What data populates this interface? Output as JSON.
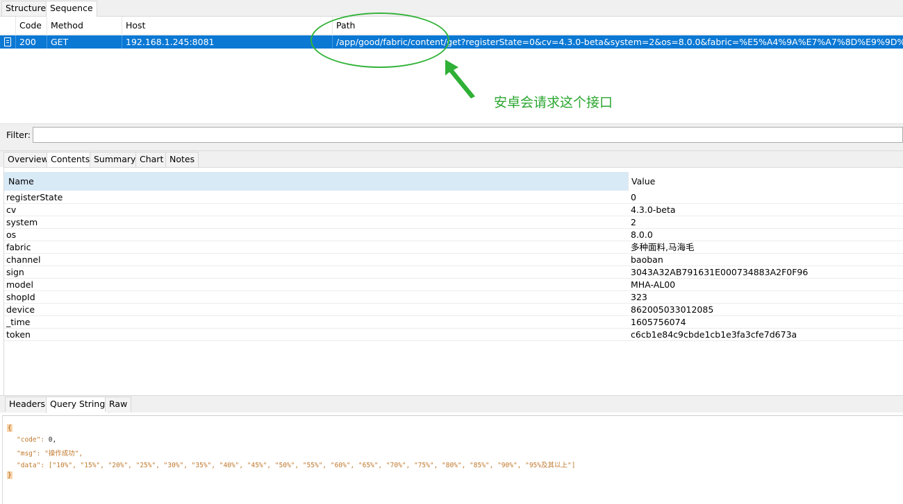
{
  "top_tabs": {
    "structure": "Structure",
    "sequence": "Sequence"
  },
  "sequence_table": {
    "columns": {
      "code": "Code",
      "method": "Method",
      "host": "Host",
      "path": "Path"
    },
    "row": {
      "code": "200",
      "method": "GET",
      "host": "192.168.1.245:8081",
      "path": "/app/good/fabric/content/get?registerState=0&cv=4.3.0-beta&system=2&os=8.0.0&fabric=%E5%A4%9A%E7%A7%8D%E9%9D%A2%E6%96"
    }
  },
  "annotation": {
    "text": "安卓会请求这个接口",
    "color": "#2aa62f"
  },
  "filter": {
    "label": "Filter:",
    "value": ""
  },
  "detail_tabs": {
    "overview": "Overview",
    "contents": "Contents",
    "summary": "Summary",
    "chart": "Chart",
    "notes": "Notes"
  },
  "contents_table": {
    "headers": {
      "name": "Name",
      "value": "Value"
    },
    "rows": [
      {
        "name": "registerState",
        "value": "0"
      },
      {
        "name": "cv",
        "value": "4.3.0-beta"
      },
      {
        "name": "system",
        "value": "2"
      },
      {
        "name": "os",
        "value": "8.0.0"
      },
      {
        "name": "fabric",
        "value": "多种面料,马海毛"
      },
      {
        "name": "channel",
        "value": "baoban"
      },
      {
        "name": "sign",
        "value": "3043A32AB791631E000734883A2F0F96"
      },
      {
        "name": "model",
        "value": "MHA-AL00"
      },
      {
        "name": "shopId",
        "value": "323"
      },
      {
        "name": "device",
        "value": "862005033012085"
      },
      {
        "name": "_time",
        "value": "1605756074"
      },
      {
        "name": "token",
        "value": "c6cb1e84c9cbde1cb1e3fa3cfe7d673a"
      }
    ]
  },
  "bottom_tabs": {
    "headers": "Headers",
    "query_string": "Query String",
    "raw": "Raw"
  },
  "response": {
    "open_brace": "{",
    "code_key": "\"code\":",
    "code_value": "0,",
    "msg_key": "\"msg\":",
    "msg_value": "\"操作成功\",",
    "data_key": "\"data\":",
    "data_value": "[\"10%\", \"15%\", \"20%\", \"25%\", \"30%\", \"35%\", \"40%\", \"45%\", \"50%\", \"55%\", \"60%\", \"65%\", \"70%\", \"75%\", \"80%\", \"85%\", \"90%\", \"95%及其以上\"]",
    "close_brace": "}"
  },
  "colors": {
    "selection": "#0b78d4",
    "header_highlight": "#d9eaf7",
    "annotation": "#34b33a"
  }
}
